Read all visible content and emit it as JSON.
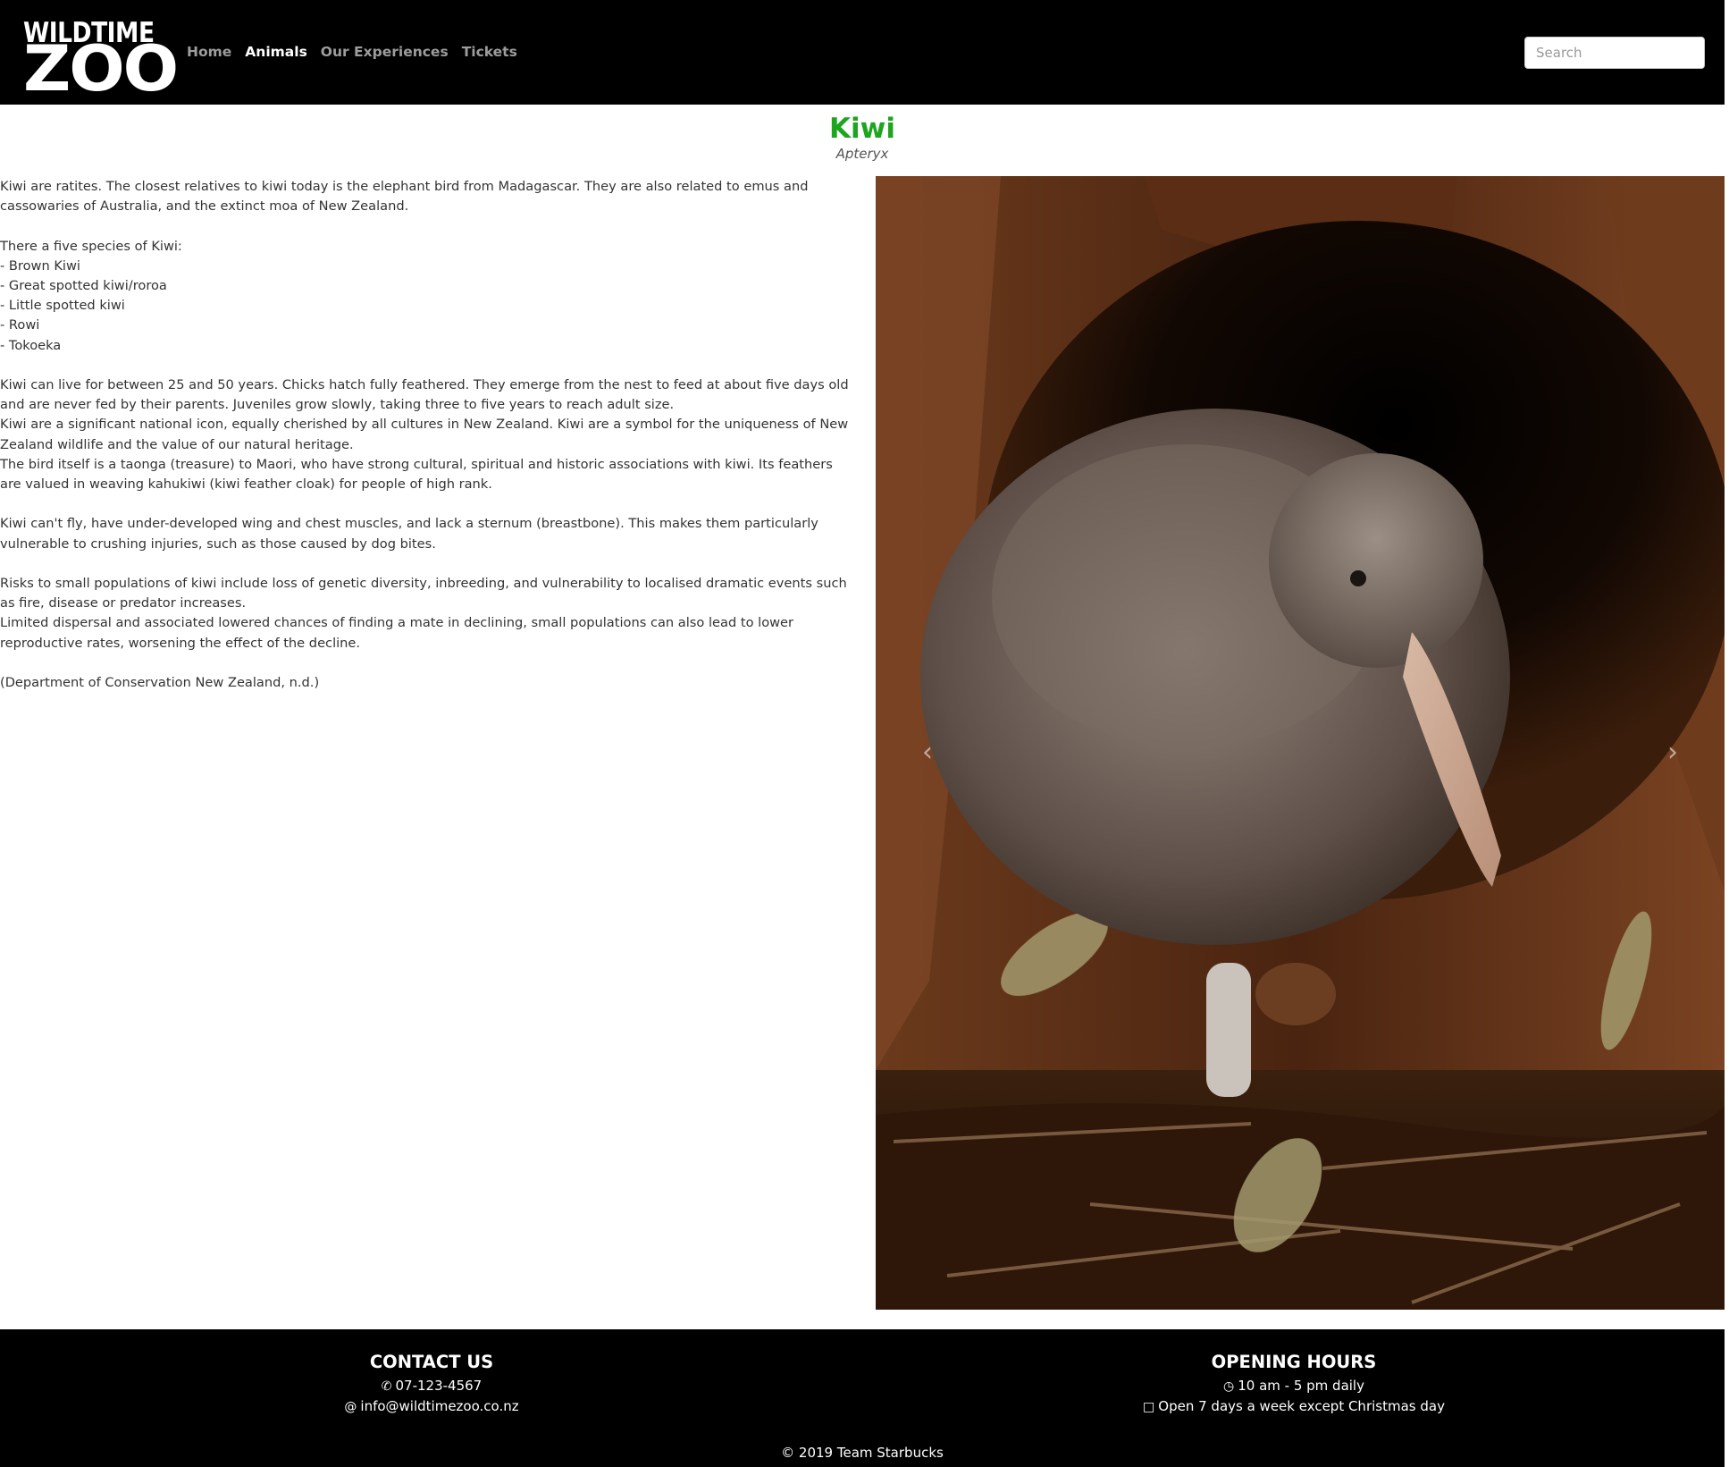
{
  "brand": {
    "logo_line1": "WILDTIME",
    "logo_line2": "ZOO"
  },
  "nav": {
    "items": [
      {
        "label": "Home",
        "active": false
      },
      {
        "label": "Animals",
        "active": true
      },
      {
        "label": "Our Experiences",
        "active": false
      },
      {
        "label": "Tickets",
        "active": false
      }
    ]
  },
  "search": {
    "placeholder": "Search",
    "value": ""
  },
  "animal": {
    "name": "Kiwi",
    "scientific_name": "Apteryx"
  },
  "description": {
    "intro": [
      "Kiwi are ratites. The closest relatives to kiwi today is the elephant bird from Madagascar. They are also related to emus and cassowaries of Australia, and the extinct moa of New Zealand."
    ],
    "species_heading": "There a five species of Kiwi:",
    "species": [
      "- Brown Kiwi",
      "- Great spotted kiwi/roroa",
      "- Little spotted kiwi",
      "- Rowi",
      "- Tokoeka"
    ],
    "life": [
      "Kiwi can live for between 25 and 50 years. Chicks hatch fully feathered. They emerge from the nest to feed at about five days old and are never fed by their parents. Juveniles grow slowly, taking three to five years to reach adult size.",
      "Kiwi are a significant national icon, equally cherished by all cultures in New Zealand. Kiwi are a symbol for the uniqueness of New Zealand wildlife and the value of our natural heritage.",
      "The bird itself is a taonga (treasure) to Maori, who have strong cultural, spiritual and historic associations with kiwi. Its feathers are valued in weaving kahukiwi (kiwi feather cloak) for people of high rank."
    ],
    "flight": "Kiwi can't fly, have under-developed wing and chest muscles, and lack a sternum (breastbone). This makes them particularly vulnerable to crushing injuries, such as those caused by dog bites.",
    "risks": [
      "Risks to small populations of kiwi include loss of genetic diversity, inbreeding, and vulnerability to localised dramatic events such as fire, disease or predator increases.",
      "Limited dispersal and associated lowered chances of finding a mate in declining, small populations can also lead to lower reproductive rates, worsening the effect of the decline."
    ],
    "source": "(Department of Conservation New Zealand, n.d.)"
  },
  "carousel": {
    "prev_icon": "chevron-left-icon",
    "next_icon": "chevron-right-icon",
    "prev_glyph": "‹",
    "next_glyph": "›"
  },
  "footer": {
    "contact_heading": "CONTACT US",
    "phone": "07-123-4567",
    "email": "info@wildtimezoo.co.nz",
    "hours_heading": "OPENING HOURS",
    "hours": "10 am - 5 pm daily",
    "days": "Open 7 days a week except Christmas day",
    "copyright": "© 2019 Team Starbucks"
  },
  "colors": {
    "navbar_bg": "#000000",
    "title_green": "#1ea51e",
    "nav_inactive": "#9d9d9d",
    "nav_active": "#ffffff"
  }
}
